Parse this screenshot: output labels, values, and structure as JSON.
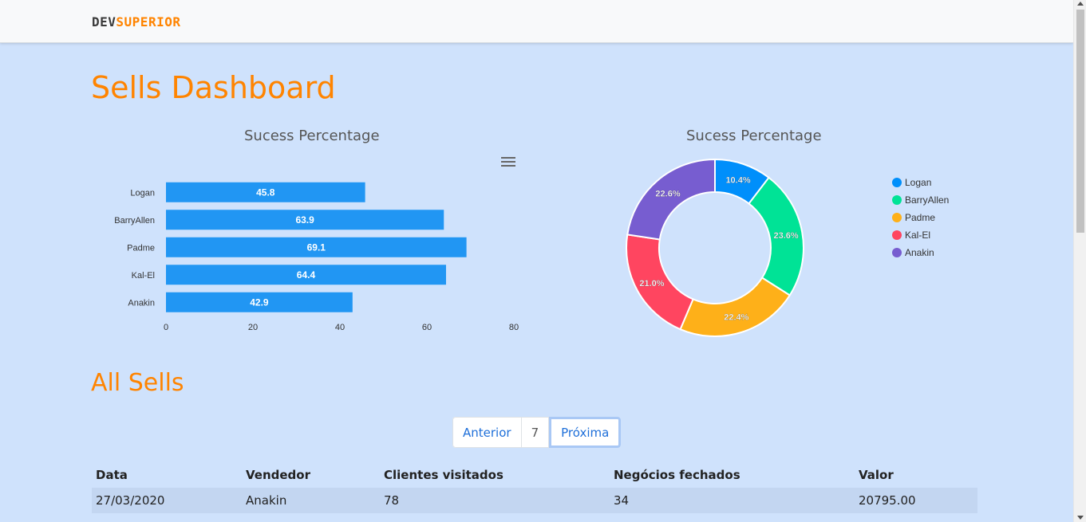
{
  "navbar": {
    "brand_dev": "DEV",
    "brand_superior": "SUPERIOR"
  },
  "page": {
    "title": "Sells Dashboard",
    "section_title": "All Sells"
  },
  "colors": {
    "accent": "#ff8400",
    "bar": "#2196f3",
    "background": "#cfe2fc"
  },
  "bar_chart": {
    "title": "Sucess Percentage",
    "menu_icon": "hamburger-menu-icon"
  },
  "donut_chart": {
    "title": "Sucess Percentage"
  },
  "chart_data": [
    {
      "type": "bar",
      "title": "Sucess Percentage",
      "orientation": "horizontal",
      "categories": [
        "Logan",
        "BarryAllen",
        "Padme",
        "Kal-El",
        "Anakin"
      ],
      "values": [
        45.8,
        63.9,
        69.1,
        64.4,
        42.9
      ],
      "xlim": [
        0,
        80
      ],
      "xticks": [
        0,
        20,
        40,
        60,
        80
      ],
      "grid": false,
      "color": "#2196f3"
    },
    {
      "type": "pie",
      "title": "Sucess Percentage",
      "donut": true,
      "labels": [
        "Logan",
        "BarryAllen",
        "Padme",
        "Kal-El",
        "Anakin"
      ],
      "values": [
        10.4,
        23.6,
        22.4,
        21.0,
        22.6
      ],
      "value_labels": [
        "10.4%",
        "23.6%",
        "22.4%",
        "21.0%",
        "22.6%"
      ],
      "colors": [
        "#008ffb",
        "#00e396",
        "#feb019",
        "#ff4560",
        "#775dd0"
      ],
      "legend": "right"
    }
  ],
  "pagination": {
    "prev_label": "Anterior",
    "page": "7",
    "next_label": "Próxima"
  },
  "table": {
    "headers": [
      "Data",
      "Vendedor",
      "Clientes visitados",
      "Negócios fechados",
      "Valor"
    ],
    "rows": [
      [
        "27/03/2020",
        "Anakin",
        "78",
        "34",
        "20795.00"
      ]
    ]
  }
}
